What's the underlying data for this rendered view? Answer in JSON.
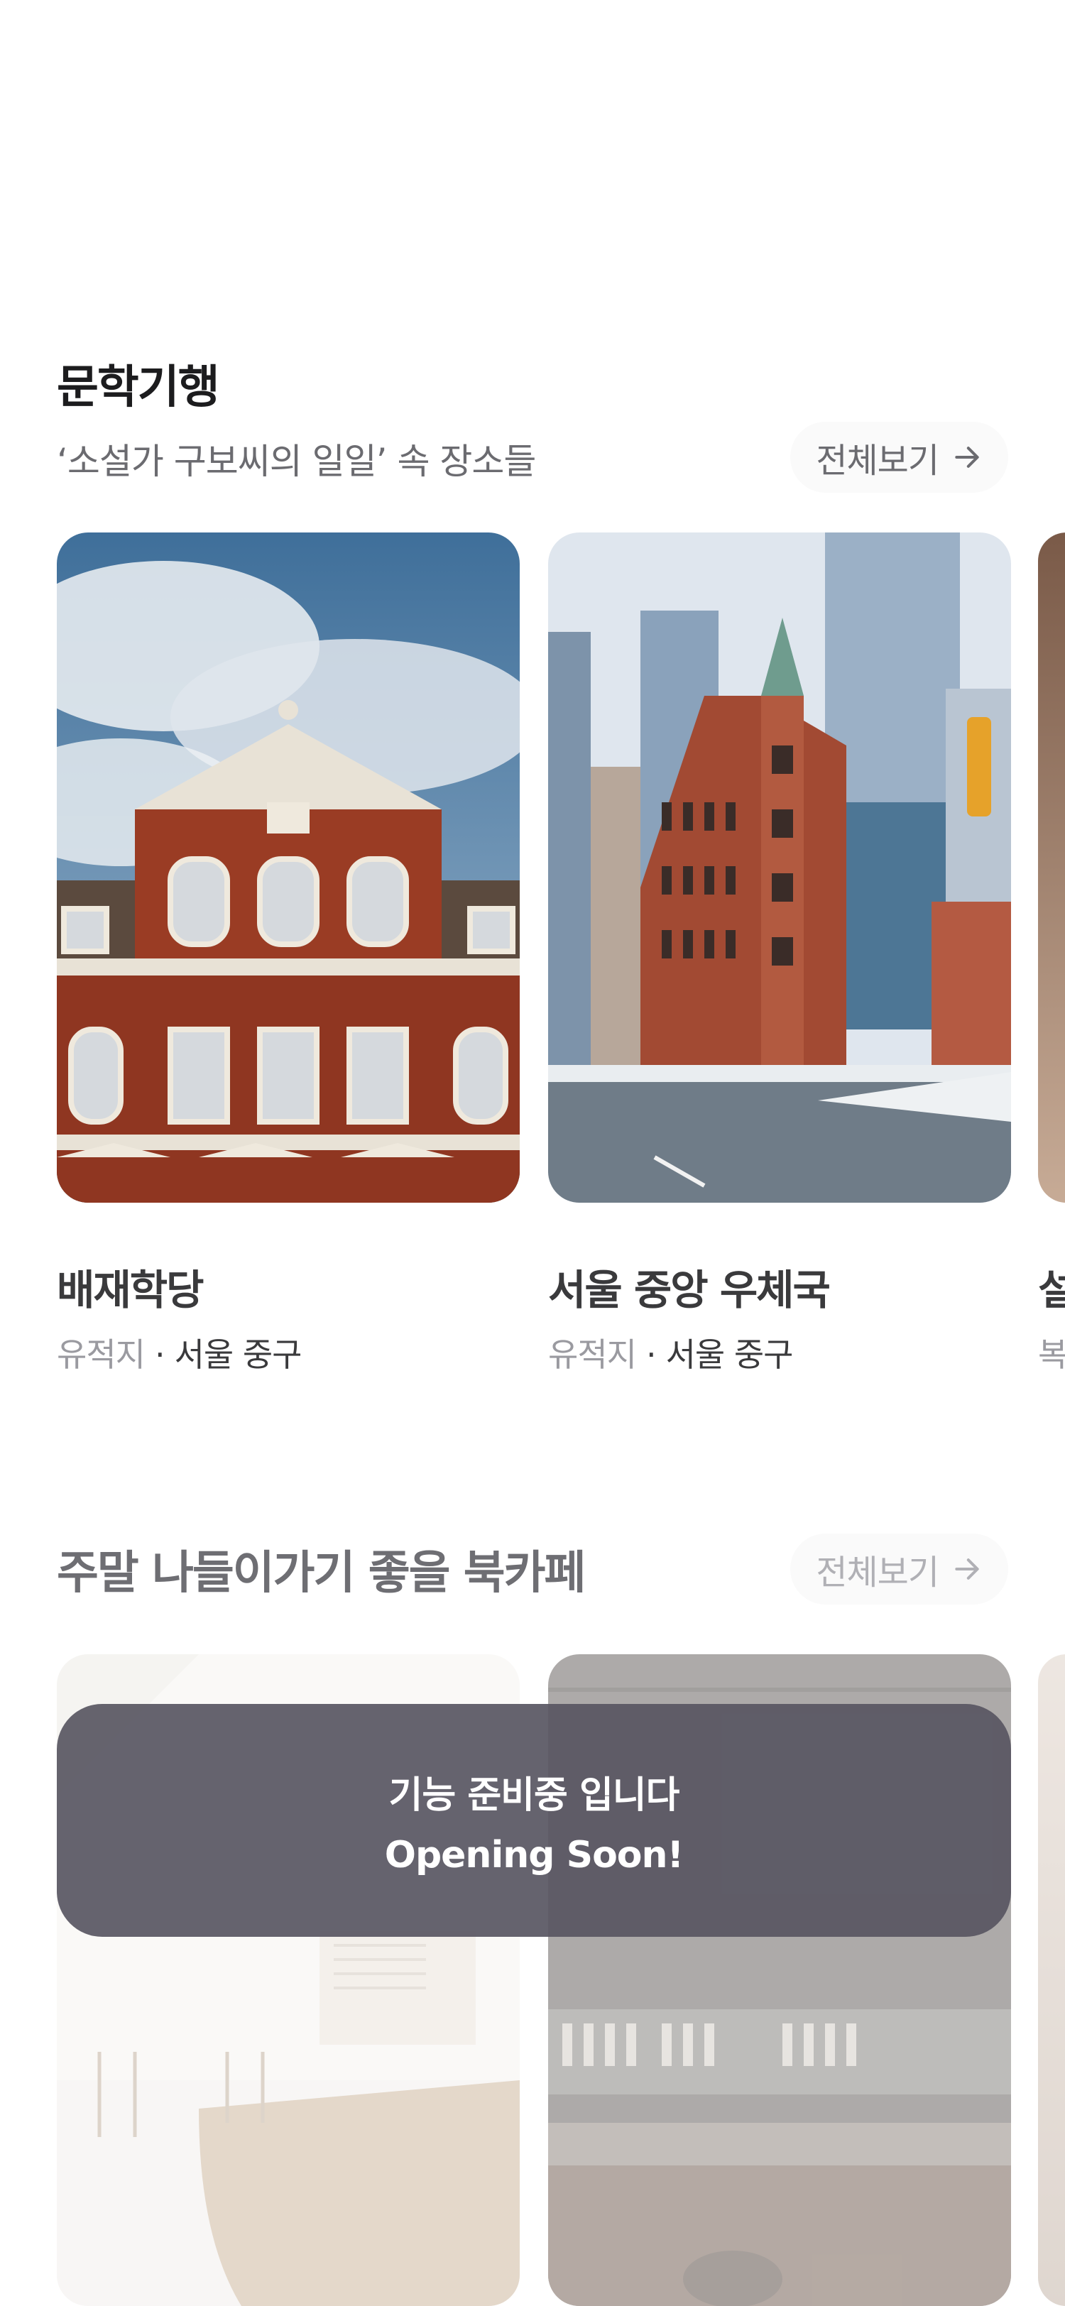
{
  "literary": {
    "title": "문학기행",
    "subtitle": "‘소설가 구보씨의 일일’ 속 장소들",
    "see_all": "전체보기",
    "cards": [
      {
        "title": "배재학당",
        "category": "유적지",
        "location": "서울 중구"
      },
      {
        "title": "서울 중앙 우체국",
        "category": "유적지",
        "location": "서울 중구"
      },
      {
        "title": "설",
        "category": "복"
      }
    ]
  },
  "bookcafe": {
    "title": "주말 나들이가기 좋을 북카페",
    "see_all": "전체보기"
  },
  "toast": {
    "line1": "기능 준비중 입니다",
    "line2": "Opening Soon!"
  }
}
